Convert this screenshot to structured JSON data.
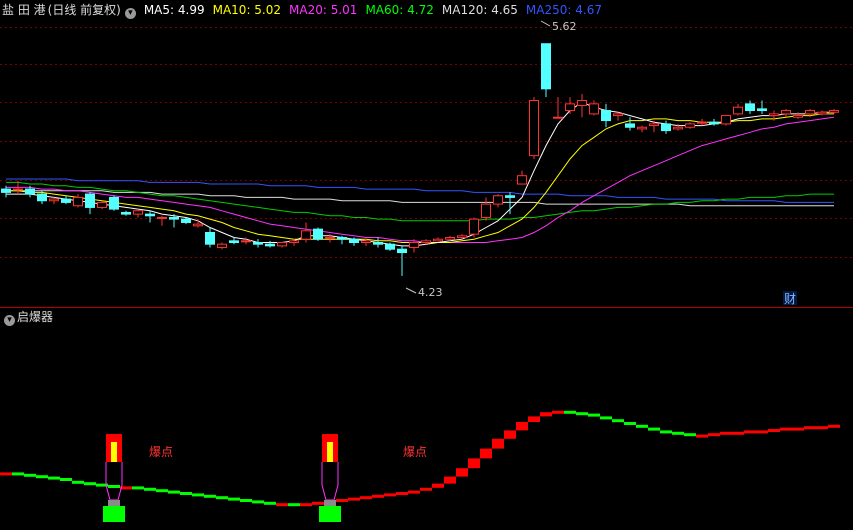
{
  "header": {
    "stock_name": "盐 田 港",
    "chart_mode": "(日线 前复权)",
    "ma": [
      {
        "label": "MA5: 4.99",
        "color": "#ffffff"
      },
      {
        "label": "MA10: 5.02",
        "color": "#ffff00"
      },
      {
        "label": "MA20: 5.01",
        "color": "#ff33ff"
      },
      {
        "label": "MA60: 4.72",
        "color": "#00ff00"
      },
      {
        "label": "MA120: 4.65",
        "color": "#dddddd"
      },
      {
        "label": "MA250: 4.67",
        "color": "#3355ff"
      }
    ]
  },
  "price_chart": {
    "high_label": "5.62",
    "low_label": "4.23",
    "caifu_label": "财",
    "ylim": [
      4.05,
      5.75
    ],
    "up_color": "#ff3232",
    "down_color": "#54ffff",
    "candles": [
      [
        4.75,
        4.77,
        4.7,
        4.73
      ],
      [
        4.75,
        4.8,
        4.72,
        4.75
      ],
      [
        4.75,
        4.77,
        4.7,
        4.72
      ],
      [
        4.72,
        4.74,
        4.66,
        4.68
      ],
      [
        4.68,
        4.7,
        4.66,
        4.69
      ],
      [
        4.69,
        4.71,
        4.66,
        4.67
      ],
      [
        4.65,
        4.72,
        4.64,
        4.7
      ],
      [
        4.72,
        4.73,
        4.6,
        4.64
      ],
      [
        4.64,
        4.68,
        4.63,
        4.67
      ],
      [
        4.7,
        4.71,
        4.62,
        4.63
      ],
      [
        4.61,
        4.62,
        4.59,
        4.6
      ],
      [
        4.6,
        4.63,
        4.58,
        4.62
      ],
      [
        4.6,
        4.62,
        4.55,
        4.59
      ],
      [
        4.58,
        4.59,
        4.53,
        4.58
      ],
      [
        4.58,
        4.6,
        4.52,
        4.57
      ],
      [
        4.57,
        4.58,
        4.54,
        4.55
      ],
      [
        4.53,
        4.57,
        4.52,
        4.54
      ],
      [
        4.49,
        4.52,
        4.4,
        4.42
      ],
      [
        4.4,
        4.43,
        4.39,
        4.42
      ],
      [
        4.44,
        4.46,
        4.42,
        4.43
      ],
      [
        4.44,
        4.46,
        4.42,
        4.44
      ],
      [
        4.43,
        4.45,
        4.4,
        4.42
      ],
      [
        4.42,
        4.44,
        4.4,
        4.41
      ],
      [
        4.41,
        4.43,
        4.4,
        4.43
      ],
      [
        4.43,
        4.45,
        4.41,
        4.44
      ],
      [
        4.45,
        4.55,
        4.43,
        4.5
      ],
      [
        4.51,
        4.52,
        4.44,
        4.45
      ],
      [
        4.46,
        4.48,
        4.43,
        4.46
      ],
      [
        4.46,
        4.47,
        4.42,
        4.45
      ],
      [
        4.45,
        4.46,
        4.41,
        4.43
      ],
      [
        4.43,
        4.45,
        4.41,
        4.44
      ],
      [
        4.43,
        4.46,
        4.4,
        4.42
      ],
      [
        4.42,
        4.43,
        4.38,
        4.39
      ],
      [
        4.39,
        4.41,
        4.23,
        4.37
      ],
      [
        4.4,
        4.45,
        4.37,
        4.43
      ],
      [
        4.43,
        4.45,
        4.42,
        4.44
      ],
      [
        4.44,
        4.46,
        4.44,
        4.45
      ],
      [
        4.45,
        4.47,
        4.44,
        4.46
      ],
      [
        4.46,
        4.48,
        4.45,
        4.47
      ],
      [
        4.48,
        4.58,
        4.46,
        4.57
      ],
      [
        4.58,
        4.7,
        4.56,
        4.66
      ],
      [
        4.66,
        4.72,
        4.64,
        4.71
      ],
      [
        4.71,
        4.73,
        4.6,
        4.7
      ],
      [
        4.78,
        4.86,
        4.78,
        4.83
      ],
      [
        4.95,
        5.3,
        4.93,
        5.28
      ],
      [
        5.62,
        5.62,
        5.3,
        5.35
      ],
      [
        5.18,
        5.3,
        5.18,
        5.18
      ],
      [
        5.22,
        5.3,
        5.2,
        5.26
      ],
      [
        5.25,
        5.32,
        5.18,
        5.28
      ],
      [
        5.2,
        5.28,
        5.19,
        5.26
      ],
      [
        5.22,
        5.26,
        5.12,
        5.16
      ],
      [
        5.19,
        5.21,
        5.16,
        5.2
      ],
      [
        5.14,
        5.18,
        5.1,
        5.12
      ],
      [
        5.11,
        5.13,
        5.09,
        5.12
      ],
      [
        5.13,
        5.16,
        5.09,
        5.14
      ],
      [
        5.14,
        5.16,
        5.08,
        5.1
      ],
      [
        5.11,
        5.14,
        5.1,
        5.12
      ],
      [
        5.12,
        5.15,
        5.11,
        5.14
      ],
      [
        5.15,
        5.17,
        5.13,
        5.15
      ],
      [
        5.15,
        5.17,
        5.13,
        5.14
      ],
      [
        5.14,
        5.19,
        5.13,
        5.19
      ],
      [
        5.2,
        5.26,
        5.19,
        5.24
      ],
      [
        5.26,
        5.28,
        5.2,
        5.22
      ],
      [
        5.23,
        5.28,
        5.2,
        5.22
      ],
      [
        5.19,
        5.22,
        5.16,
        5.2
      ],
      [
        5.2,
        5.23,
        5.18,
        5.22
      ],
      [
        5.18,
        5.21,
        5.17,
        5.19
      ],
      [
        5.2,
        5.23,
        5.18,
        5.22
      ],
      [
        5.2,
        5.22,
        5.19,
        5.21
      ],
      [
        5.21,
        5.23,
        5.2,
        5.22
      ]
    ],
    "ma5": [
      4.72,
      4.72,
      4.72,
      4.71,
      4.7,
      4.69,
      4.68,
      4.67,
      4.66,
      4.65,
      4.64,
      4.63,
      4.62,
      4.6,
      4.59,
      4.58,
      4.56,
      4.52,
      4.49,
      4.46,
      4.45,
      4.43,
      4.43,
      4.43,
      4.44,
      4.47,
      4.47,
      4.47,
      4.46,
      4.45,
      4.44,
      4.43,
      4.42,
      4.41,
      4.41,
      4.42,
      4.43,
      4.44,
      4.45,
      4.48,
      4.52,
      4.56,
      4.63,
      4.7,
      4.86,
      5.01,
      5.14,
      5.22,
      5.27,
      5.24,
      5.22,
      5.21,
      5.19,
      5.17,
      5.15,
      5.14,
      5.13,
      5.13,
      5.13,
      5.14,
      5.15,
      5.17,
      5.18,
      5.19,
      5.19,
      5.2,
      5.2,
      5.2,
      5.21,
      5.21
    ],
    "ma10": [
      4.74,
      4.74,
      4.73,
      4.73,
      4.72,
      4.71,
      4.7,
      4.69,
      4.68,
      4.67,
      4.66,
      4.65,
      4.64,
      4.63,
      4.62,
      4.6,
      4.59,
      4.57,
      4.55,
      4.52,
      4.5,
      4.48,
      4.47,
      4.46,
      4.45,
      4.45,
      4.45,
      4.45,
      4.45,
      4.45,
      4.45,
      4.44,
      4.44,
      4.43,
      4.43,
      4.43,
      4.43,
      4.43,
      4.44,
      4.45,
      4.47,
      4.49,
      4.53,
      4.57,
      4.64,
      4.73,
      4.83,
      4.93,
      5.01,
      5.06,
      5.11,
      5.14,
      5.16,
      5.16,
      5.17,
      5.17,
      5.16,
      5.16,
      5.15,
      5.15,
      5.15,
      5.16,
      5.16,
      5.17,
      5.17,
      5.18,
      5.19,
      5.19,
      5.2,
      5.2
    ],
    "ma20": [
      4.76,
      4.76,
      4.76,
      4.75,
      4.75,
      4.74,
      4.74,
      4.73,
      4.72,
      4.71,
      4.7,
      4.7,
      4.69,
      4.68,
      4.67,
      4.66,
      4.65,
      4.64,
      4.62,
      4.6,
      4.58,
      4.56,
      4.54,
      4.53,
      4.52,
      4.51,
      4.5,
      4.49,
      4.48,
      4.47,
      4.46,
      4.46,
      4.45,
      4.44,
      4.44,
      4.43,
      4.43,
      4.43,
      4.43,
      4.43,
      4.43,
      4.44,
      4.45,
      4.46,
      4.49,
      4.53,
      4.58,
      4.62,
      4.67,
      4.71,
      4.75,
      4.79,
      4.83,
      4.86,
      4.89,
      4.92,
      4.95,
      4.98,
      5.01,
      5.03,
      5.05,
      5.07,
      5.09,
      5.11,
      5.12,
      5.14,
      5.15,
      5.16,
      5.17,
      5.18
    ],
    "ma60": [
      4.79,
      4.79,
      4.78,
      4.78,
      4.77,
      4.77,
      4.76,
      4.76,
      4.75,
      4.74,
      4.74,
      4.73,
      4.72,
      4.71,
      4.71,
      4.7,
      4.69,
      4.68,
      4.67,
      4.66,
      4.65,
      4.64,
      4.63,
      4.62,
      4.61,
      4.61,
      4.6,
      4.59,
      4.59,
      4.58,
      4.58,
      4.57,
      4.57,
      4.56,
      4.56,
      4.56,
      4.56,
      4.56,
      4.56,
      4.56,
      4.57,
      4.57,
      4.57,
      4.58,
      4.58,
      4.59,
      4.6,
      4.61,
      4.62,
      4.62,
      4.63,
      4.64,
      4.64,
      4.65,
      4.66,
      4.66,
      4.67,
      4.67,
      4.68,
      4.68,
      4.69,
      4.69,
      4.7,
      4.7,
      4.7,
      4.71,
      4.71,
      4.72,
      4.72,
      4.72
    ],
    "ma120": [
      4.74,
      4.74,
      4.74,
      4.74,
      4.74,
      4.74,
      4.74,
      4.74,
      4.74,
      4.73,
      4.73,
      4.73,
      4.73,
      4.72,
      4.72,
      4.72,
      4.72,
      4.71,
      4.71,
      4.71,
      4.7,
      4.7,
      4.7,
      4.7,
      4.69,
      4.69,
      4.69,
      4.69,
      4.68,
      4.68,
      4.68,
      4.68,
      4.68,
      4.67,
      4.67,
      4.67,
      4.67,
      4.67,
      4.67,
      4.67,
      4.67,
      4.67,
      4.67,
      4.67,
      4.67,
      4.66,
      4.66,
      4.66,
      4.66,
      4.66,
      4.66,
      4.66,
      4.66,
      4.66,
      4.66,
      4.66,
      4.66,
      4.65,
      4.65,
      4.65,
      4.65,
      4.65,
      4.65,
      4.65,
      4.65,
      4.65,
      4.65,
      4.65,
      4.65,
      4.65
    ],
    "ma250": [
      4.81,
      4.81,
      4.81,
      4.81,
      4.81,
      4.81,
      4.8,
      4.8,
      4.8,
      4.8,
      4.8,
      4.8,
      4.79,
      4.79,
      4.79,
      4.79,
      4.79,
      4.78,
      4.78,
      4.78,
      4.78,
      4.78,
      4.77,
      4.77,
      4.77,
      4.77,
      4.76,
      4.76,
      4.76,
      4.76,
      4.75,
      4.75,
      4.75,
      4.75,
      4.75,
      4.74,
      4.74,
      4.74,
      4.74,
      4.73,
      4.73,
      4.73,
      4.73,
      4.72,
      4.72,
      4.72,
      4.72,
      4.71,
      4.71,
      4.71,
      4.71,
      4.7,
      4.7,
      4.7,
      4.7,
      4.69,
      4.69,
      4.69,
      4.69,
      4.69,
      4.68,
      4.68,
      4.68,
      4.68,
      4.68,
      4.67,
      4.67,
      4.67,
      4.67,
      4.67
    ]
  },
  "indicator": {
    "title": "启爆器",
    "signal_label": "爆点",
    "signal_bars": [
      9,
      27
    ],
    "ylim": [
      0,
      100
    ],
    "values": [
      34,
      33,
      32,
      31,
      30,
      28,
      27,
      26,
      25,
      24,
      24,
      23,
      22,
      21,
      20,
      19,
      18,
      17,
      16,
      15,
      14,
      13,
      12,
      12,
      11,
      12,
      13,
      14,
      15,
      16,
      17,
      18,
      19,
      20,
      21,
      23,
      26,
      31,
      37,
      44,
      51,
      58,
      64,
      70,
      74,
      77,
      78,
      77,
      76,
      74,
      72,
      70,
      68,
      66,
      64,
      63,
      62,
      61,
      61,
      62,
      63,
      63,
      64,
      64,
      65,
      66,
      66,
      67,
      67,
      68
    ]
  }
}
